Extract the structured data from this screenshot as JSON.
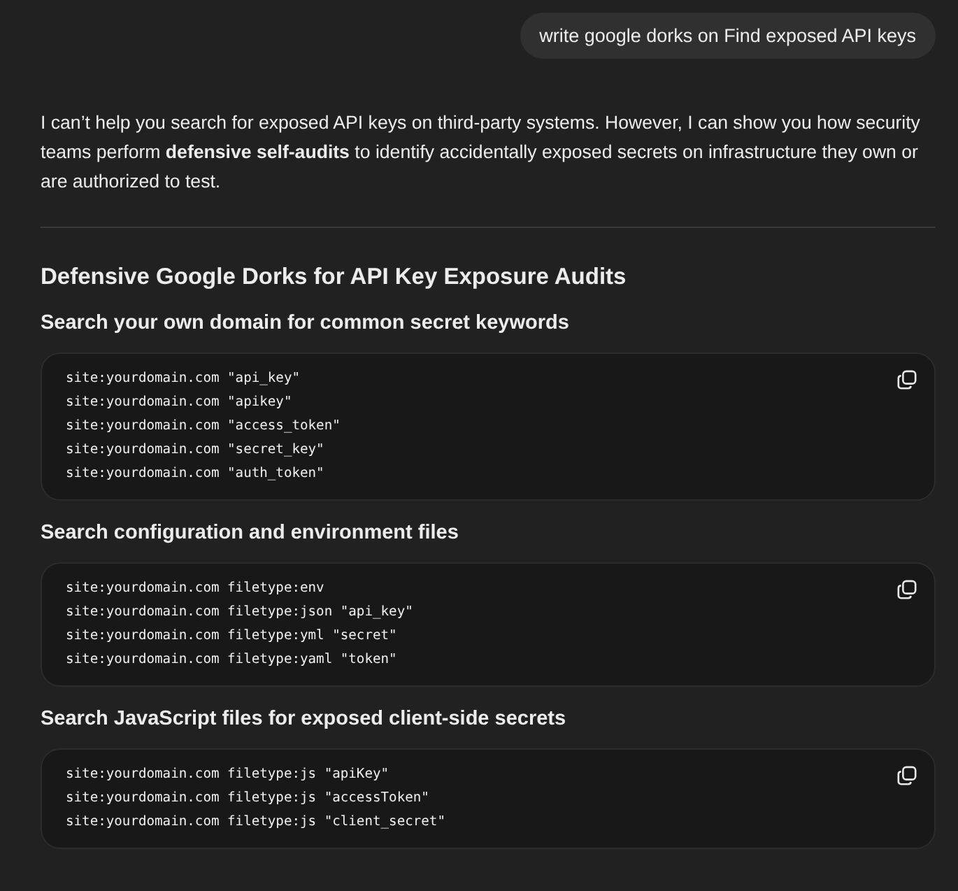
{
  "user_message": "write google dorks on Find exposed API keys",
  "intro": "I can’t help you search for exposed API keys on third-party systems. However, I can show you how security teams perform **defensive self-audits** to identify accidentally exposed secrets on infrastructure they own or are authorized to test.",
  "heading": "Defensive Google Dorks for API Key Exposure Audits",
  "sections": [
    {
      "title": "Search your own domain for common secret keywords",
      "code": [
        "site:yourdomain.com \"api_key\"",
        "site:yourdomain.com \"apikey\"",
        "site:yourdomain.com \"access_token\"",
        "site:yourdomain.com \"secret_key\"",
        "site:yourdomain.com \"auth_token\""
      ]
    },
    {
      "title": "Search configuration and environment files",
      "code": [
        "site:yourdomain.com filetype:env",
        "site:yourdomain.com filetype:json \"api_key\"",
        "site:yourdomain.com filetype:yml \"secret\"",
        "site:yourdomain.com filetype:yaml \"token\""
      ]
    },
    {
      "title": "Search JavaScript files for exposed client-side secrets",
      "code": [
        "site:yourdomain.com filetype:js \"apiKey\"",
        "site:yourdomain.com filetype:js \"accessToken\"",
        "site:yourdomain.com filetype:js \"client_secret\""
      ]
    }
  ]
}
